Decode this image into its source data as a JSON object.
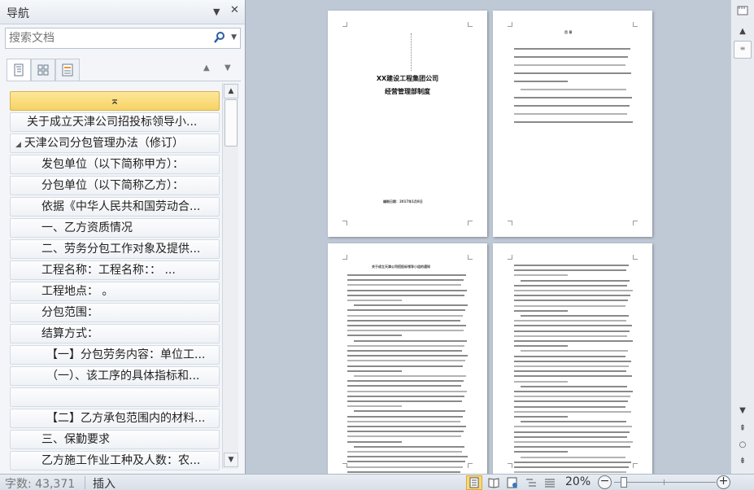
{
  "nav": {
    "title": "导航",
    "dropdown_glyph": "▼",
    "close_glyph": "✕",
    "search_placeholder": "搜索文档",
    "tree": [
      {
        "label": "⌅",
        "level": 0,
        "selected": true
      },
      {
        "label": "关于成立天津公司招投标领导小...",
        "level": 1
      },
      {
        "label": "天津公司分包管理办法（修订）",
        "level": 0,
        "expanded": true
      },
      {
        "label": "发包单位（以下简称甲方）：",
        "level": 2
      },
      {
        "label": "分包单位（以下简称乙方）：",
        "level": 2
      },
      {
        "label": "依据《中华人民共和国劳动合...",
        "level": 2
      },
      {
        "label": "一、乙方资质情况",
        "level": 2
      },
      {
        "label": "二、劳务分包工作对象及提供...",
        "level": 2
      },
      {
        "label": "工程名称：工程名称：：      ...",
        "level": 2
      },
      {
        "label": "工程地点：                  。",
        "level": 2
      },
      {
        "label": "分包范围：",
        "level": 2
      },
      {
        "label": "结算方式：",
        "level": 2
      },
      {
        "label": "【一】分包劳务内容：单位工...",
        "level": 3
      },
      {
        "label": "（一）、该工序的具体指标和...",
        "level": 3
      },
      {
        "label": "",
        "level": 3
      },
      {
        "label": "【二】乙方承包范围内的材料...",
        "level": 3
      },
      {
        "label": "三、保勤要求",
        "level": 2
      },
      {
        "label": "乙方施工作业工种及人数：农...",
        "level": 2
      }
    ]
  },
  "pages": {
    "cover_title_1": "XX建设工程集团公司",
    "cover_title_2": "经营管理部制度",
    "cover_footer": "编制日期：2017年1月8日",
    "toc_title": "目  录",
    "p3_heading": "关于成立天津公司招投标领导小组的通知"
  },
  "status": {
    "word_count": "字数: 43,371",
    "insert_mode": "插入",
    "zoom_level": "20%",
    "zoom_percent": 20
  },
  "colors": {
    "selected_item": "#f7d364",
    "workspace": "#bfc9d6"
  }
}
